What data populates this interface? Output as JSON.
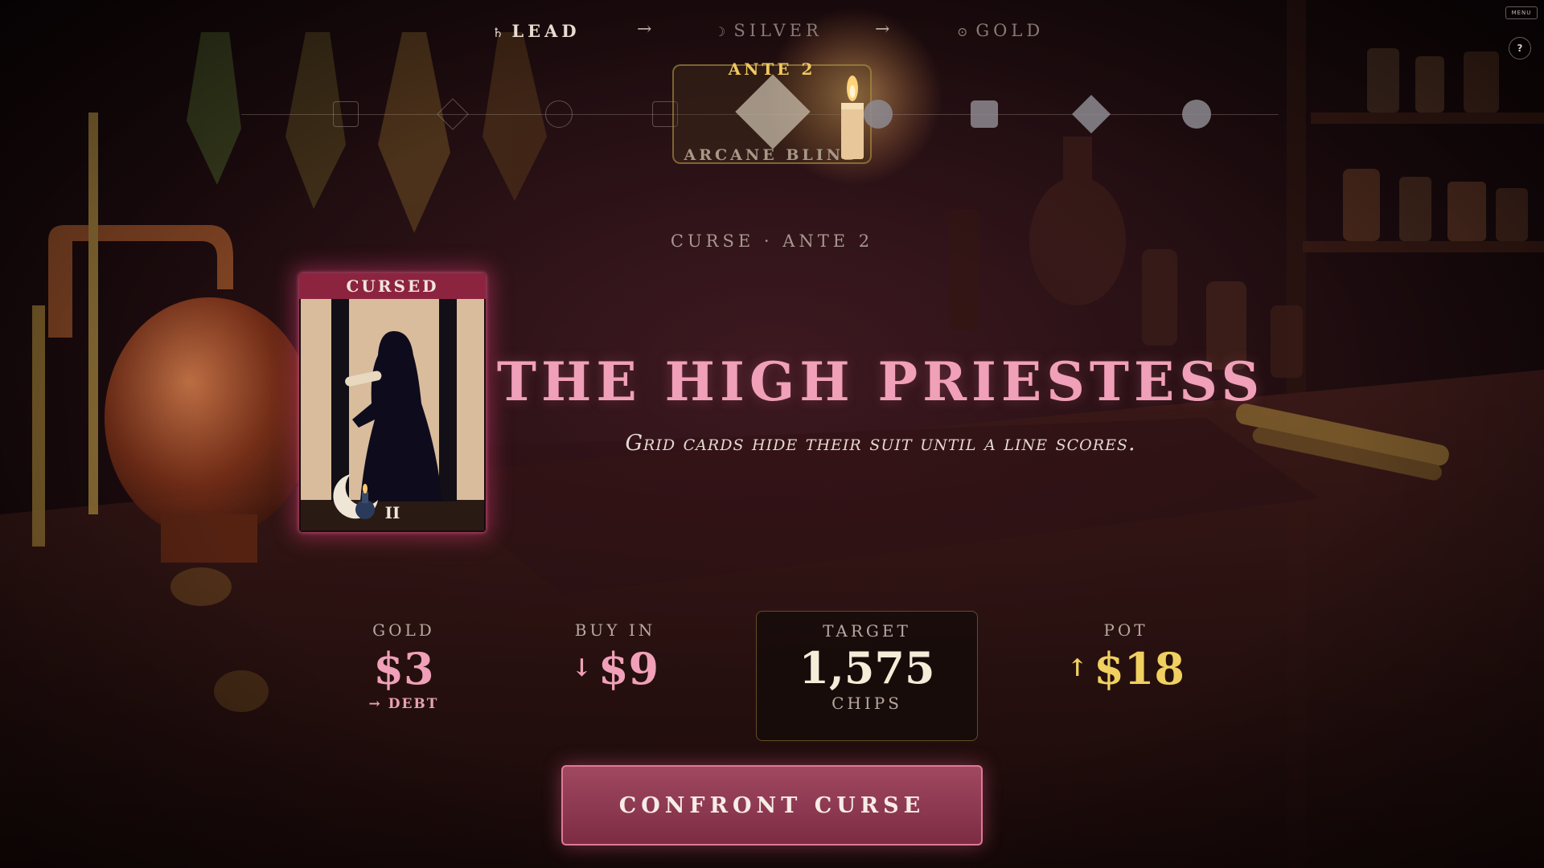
{
  "progression": {
    "tiers": [
      {
        "glyph": "♄",
        "label": "LEAD",
        "state": "current"
      },
      {
        "glyph": "☽",
        "label": "SILVER",
        "state": "locked"
      },
      {
        "glyph": "⊙",
        "label": "GOLD",
        "state": "locked"
      }
    ],
    "arrow": "→"
  },
  "menu_label": "MENU",
  "help_label": "?",
  "blind_track": {
    "current_ante": "ANTE 2",
    "current_blind": "ARCANE BLIND",
    "nodes": [
      "hollow-square",
      "hollow-diamond",
      "hollow-circle",
      "hollow-square",
      "current-diamond",
      "solid-circle",
      "solid-square",
      "solid-diamond",
      "solid-circle"
    ]
  },
  "curse": {
    "subtitle": "CURSE · ANTE 2",
    "card_banner": "CURSED",
    "card_numeral": "II",
    "title": "THE HIGH PRIESTESS",
    "description": "Grid cards hide their suit until a line scores."
  },
  "stats": {
    "gold": {
      "label": "GOLD",
      "value": "$3",
      "note": "→ DEBT"
    },
    "buy_in": {
      "label": "BUY IN",
      "arrow": "↓",
      "value": "$9"
    },
    "target": {
      "label": "TARGET",
      "value": "1,575",
      "unit": "CHIPS"
    },
    "pot": {
      "label": "POT",
      "arrow": "↑",
      "value": "$18"
    }
  },
  "action": {
    "confront_label": "CONFRONT CURSE"
  },
  "colors": {
    "accent_pink": "#f0a0b8",
    "gold": "#f0d060",
    "button": "#8c2f48",
    "ante_gold": "#f0c860"
  }
}
